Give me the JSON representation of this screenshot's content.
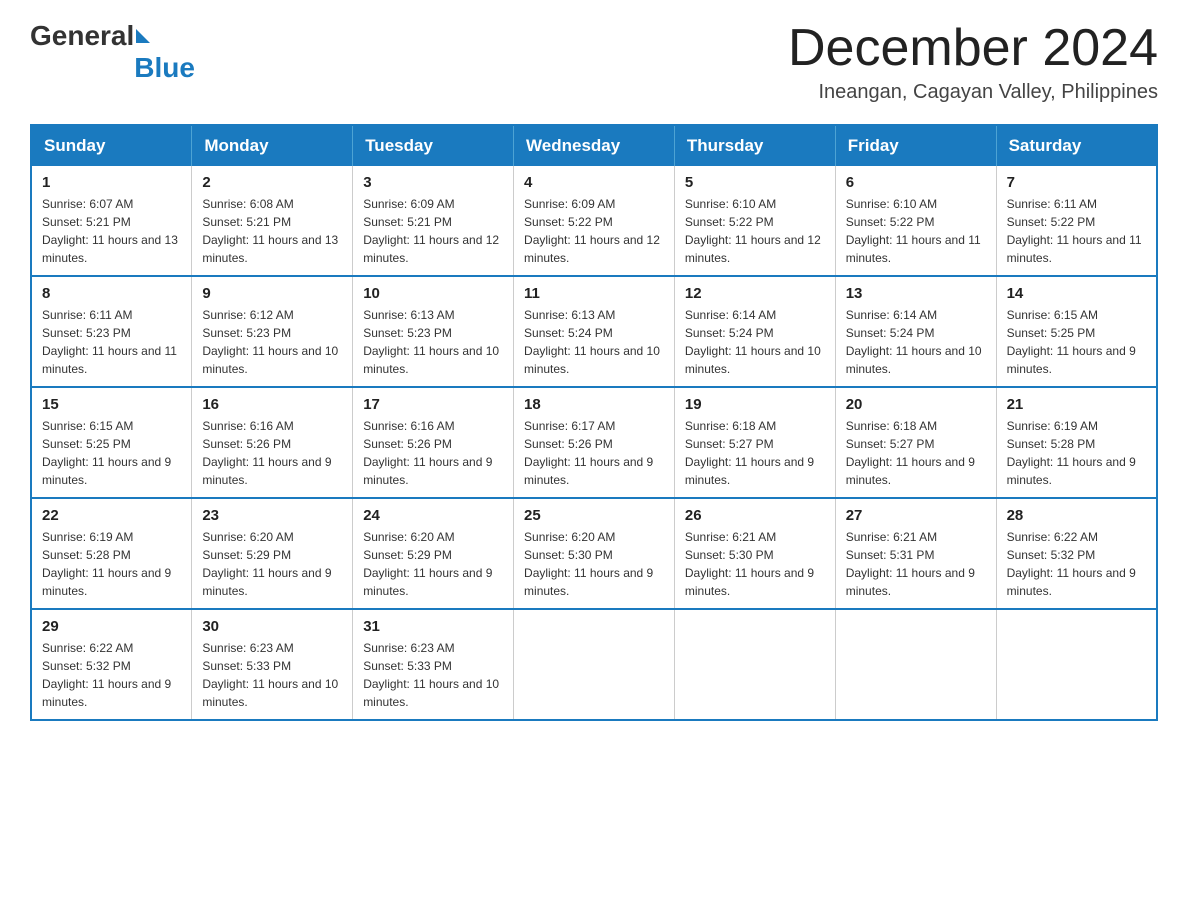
{
  "header": {
    "logo": {
      "general": "General",
      "blue": "Blue"
    },
    "title": "December 2024",
    "subtitle": "Ineangan, Cagayan Valley, Philippines"
  },
  "calendar": {
    "days_of_week": [
      "Sunday",
      "Monday",
      "Tuesday",
      "Wednesday",
      "Thursday",
      "Friday",
      "Saturday"
    ],
    "weeks": [
      [
        {
          "day": "1",
          "sunrise": "6:07 AM",
          "sunset": "5:21 PM",
          "daylight": "11 hours and 13 minutes."
        },
        {
          "day": "2",
          "sunrise": "6:08 AM",
          "sunset": "5:21 PM",
          "daylight": "11 hours and 13 minutes."
        },
        {
          "day": "3",
          "sunrise": "6:09 AM",
          "sunset": "5:21 PM",
          "daylight": "11 hours and 12 minutes."
        },
        {
          "day": "4",
          "sunrise": "6:09 AM",
          "sunset": "5:22 PM",
          "daylight": "11 hours and 12 minutes."
        },
        {
          "day": "5",
          "sunrise": "6:10 AM",
          "sunset": "5:22 PM",
          "daylight": "11 hours and 12 minutes."
        },
        {
          "day": "6",
          "sunrise": "6:10 AM",
          "sunset": "5:22 PM",
          "daylight": "11 hours and 11 minutes."
        },
        {
          "day": "7",
          "sunrise": "6:11 AM",
          "sunset": "5:22 PM",
          "daylight": "11 hours and 11 minutes."
        }
      ],
      [
        {
          "day": "8",
          "sunrise": "6:11 AM",
          "sunset": "5:23 PM",
          "daylight": "11 hours and 11 minutes."
        },
        {
          "day": "9",
          "sunrise": "6:12 AM",
          "sunset": "5:23 PM",
          "daylight": "11 hours and 10 minutes."
        },
        {
          "day": "10",
          "sunrise": "6:13 AM",
          "sunset": "5:23 PM",
          "daylight": "11 hours and 10 minutes."
        },
        {
          "day": "11",
          "sunrise": "6:13 AM",
          "sunset": "5:24 PM",
          "daylight": "11 hours and 10 minutes."
        },
        {
          "day": "12",
          "sunrise": "6:14 AM",
          "sunset": "5:24 PM",
          "daylight": "11 hours and 10 minutes."
        },
        {
          "day": "13",
          "sunrise": "6:14 AM",
          "sunset": "5:24 PM",
          "daylight": "11 hours and 10 minutes."
        },
        {
          "day": "14",
          "sunrise": "6:15 AM",
          "sunset": "5:25 PM",
          "daylight": "11 hours and 9 minutes."
        }
      ],
      [
        {
          "day": "15",
          "sunrise": "6:15 AM",
          "sunset": "5:25 PM",
          "daylight": "11 hours and 9 minutes."
        },
        {
          "day": "16",
          "sunrise": "6:16 AM",
          "sunset": "5:26 PM",
          "daylight": "11 hours and 9 minutes."
        },
        {
          "day": "17",
          "sunrise": "6:16 AM",
          "sunset": "5:26 PM",
          "daylight": "11 hours and 9 minutes."
        },
        {
          "day": "18",
          "sunrise": "6:17 AM",
          "sunset": "5:26 PM",
          "daylight": "11 hours and 9 minutes."
        },
        {
          "day": "19",
          "sunrise": "6:18 AM",
          "sunset": "5:27 PM",
          "daylight": "11 hours and 9 minutes."
        },
        {
          "day": "20",
          "sunrise": "6:18 AM",
          "sunset": "5:27 PM",
          "daylight": "11 hours and 9 minutes."
        },
        {
          "day": "21",
          "sunrise": "6:19 AM",
          "sunset": "5:28 PM",
          "daylight": "11 hours and 9 minutes."
        }
      ],
      [
        {
          "day": "22",
          "sunrise": "6:19 AM",
          "sunset": "5:28 PM",
          "daylight": "11 hours and 9 minutes."
        },
        {
          "day": "23",
          "sunrise": "6:20 AM",
          "sunset": "5:29 PM",
          "daylight": "11 hours and 9 minutes."
        },
        {
          "day": "24",
          "sunrise": "6:20 AM",
          "sunset": "5:29 PM",
          "daylight": "11 hours and 9 minutes."
        },
        {
          "day": "25",
          "sunrise": "6:20 AM",
          "sunset": "5:30 PM",
          "daylight": "11 hours and 9 minutes."
        },
        {
          "day": "26",
          "sunrise": "6:21 AM",
          "sunset": "5:30 PM",
          "daylight": "11 hours and 9 minutes."
        },
        {
          "day": "27",
          "sunrise": "6:21 AM",
          "sunset": "5:31 PM",
          "daylight": "11 hours and 9 minutes."
        },
        {
          "day": "28",
          "sunrise": "6:22 AM",
          "sunset": "5:32 PM",
          "daylight": "11 hours and 9 minutes."
        }
      ],
      [
        {
          "day": "29",
          "sunrise": "6:22 AM",
          "sunset": "5:32 PM",
          "daylight": "11 hours and 9 minutes."
        },
        {
          "day": "30",
          "sunrise": "6:23 AM",
          "sunset": "5:33 PM",
          "daylight": "11 hours and 10 minutes."
        },
        {
          "day": "31",
          "sunrise": "6:23 AM",
          "sunset": "5:33 PM",
          "daylight": "11 hours and 10 minutes."
        },
        null,
        null,
        null,
        null
      ]
    ]
  }
}
